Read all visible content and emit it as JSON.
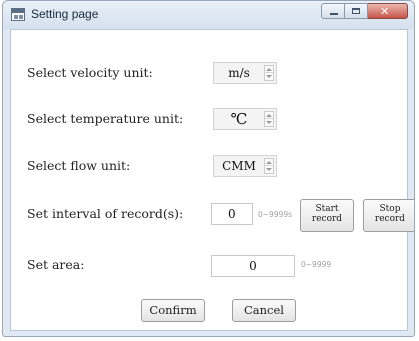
{
  "window": {
    "title": "Setting page"
  },
  "fields": {
    "velocity": {
      "label": "Select velocity unit:",
      "value": "m/s"
    },
    "temperature": {
      "label": "Select temperature unit:",
      "value": "℃"
    },
    "flow": {
      "label": "Select flow unit:",
      "value": "CMM"
    },
    "interval": {
      "label": "Set interval of record(s):",
      "value": "0",
      "range_hint": "0~9999s"
    },
    "area": {
      "label": "Set area:",
      "value": "0",
      "range_hint": "0~9999"
    }
  },
  "buttons": {
    "start_record_line1": "Start",
    "start_record_line2": "record",
    "stop_record_line1": "Stop",
    "stop_record_line2": "record",
    "confirm": "Confirm",
    "cancel": "Cancel"
  },
  "icons": {
    "app": "settings-window-icon",
    "minimize": "minimize-icon",
    "maximize": "maximize-icon",
    "close": "close-icon",
    "spinner": "spinner-arrows-icon"
  },
  "colors": {
    "window_frame": "#dfe8f3",
    "close_button": "#c8554a",
    "hint_text": "#a0a0a0"
  }
}
